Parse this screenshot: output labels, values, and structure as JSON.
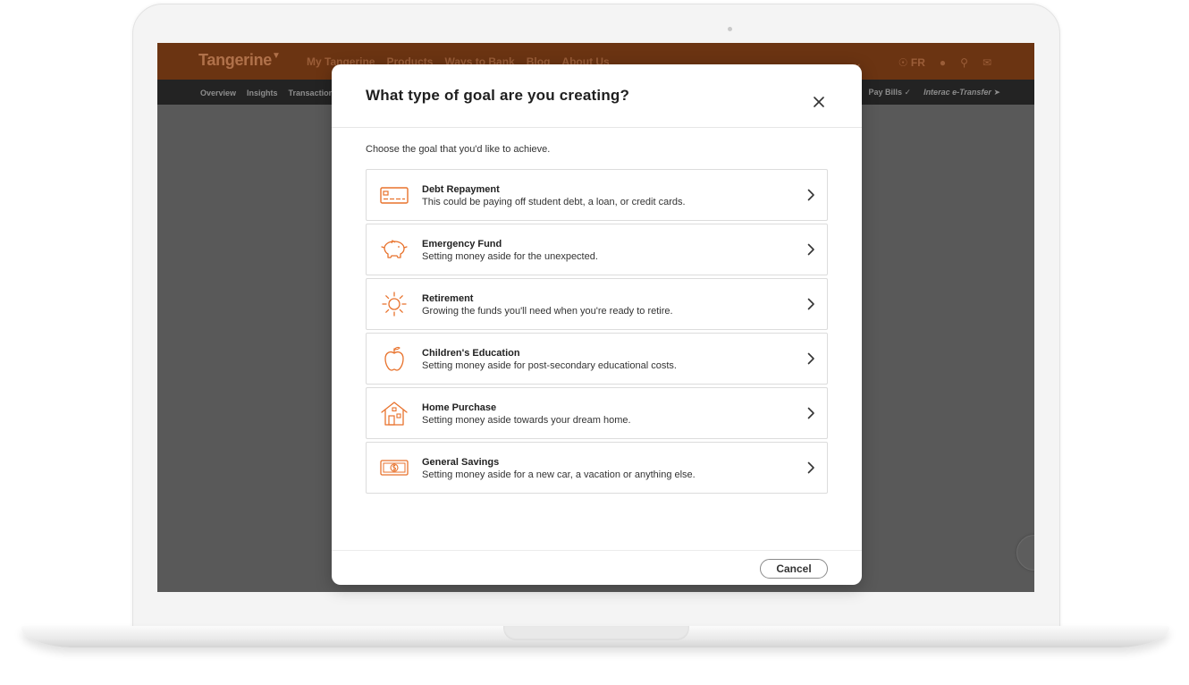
{
  "app": {
    "brand": "Tangerine",
    "nav_links": [
      "My Tangerine",
      "Products",
      "Ways to Bank",
      "Blog",
      "About Us"
    ],
    "lang_label": "FR",
    "subnav_left": [
      "Overview",
      "Insights",
      "Transactions"
    ],
    "subnav_right": [
      {
        "label": "Pay Bills",
        "icon": "checkmark-icon"
      },
      {
        "label": "Interac e-Transfer",
        "icon": "paper-plane-icon"
      }
    ]
  },
  "modal": {
    "title": "What type of goal are you creating?",
    "intro": "Choose the goal that you'd like to achieve.",
    "cancel_label": "Cancel",
    "accent_color": "#e8722c",
    "goals": [
      {
        "name": "Debt Repayment",
        "description": "This could be paying off student debt, a loan, or credit cards.",
        "icon": "credit-card-icon"
      },
      {
        "name": "Emergency Fund",
        "description": "Setting money aside for the unexpected.",
        "icon": "piggy-bank-icon"
      },
      {
        "name": "Retirement",
        "description": "Growing the funds you'll need when you're ready to retire.",
        "icon": "sun-icon"
      },
      {
        "name": "Children's Education",
        "description": "Setting money aside for post-secondary educational costs.",
        "icon": "apple-icon"
      },
      {
        "name": "Home Purchase",
        "description": "Setting money aside towards your dream home.",
        "icon": "house-icon"
      },
      {
        "name": "General Savings",
        "description": "Setting money aside for a new car, a vacation or anything else.",
        "icon": "dollar-bill-icon"
      }
    ]
  }
}
